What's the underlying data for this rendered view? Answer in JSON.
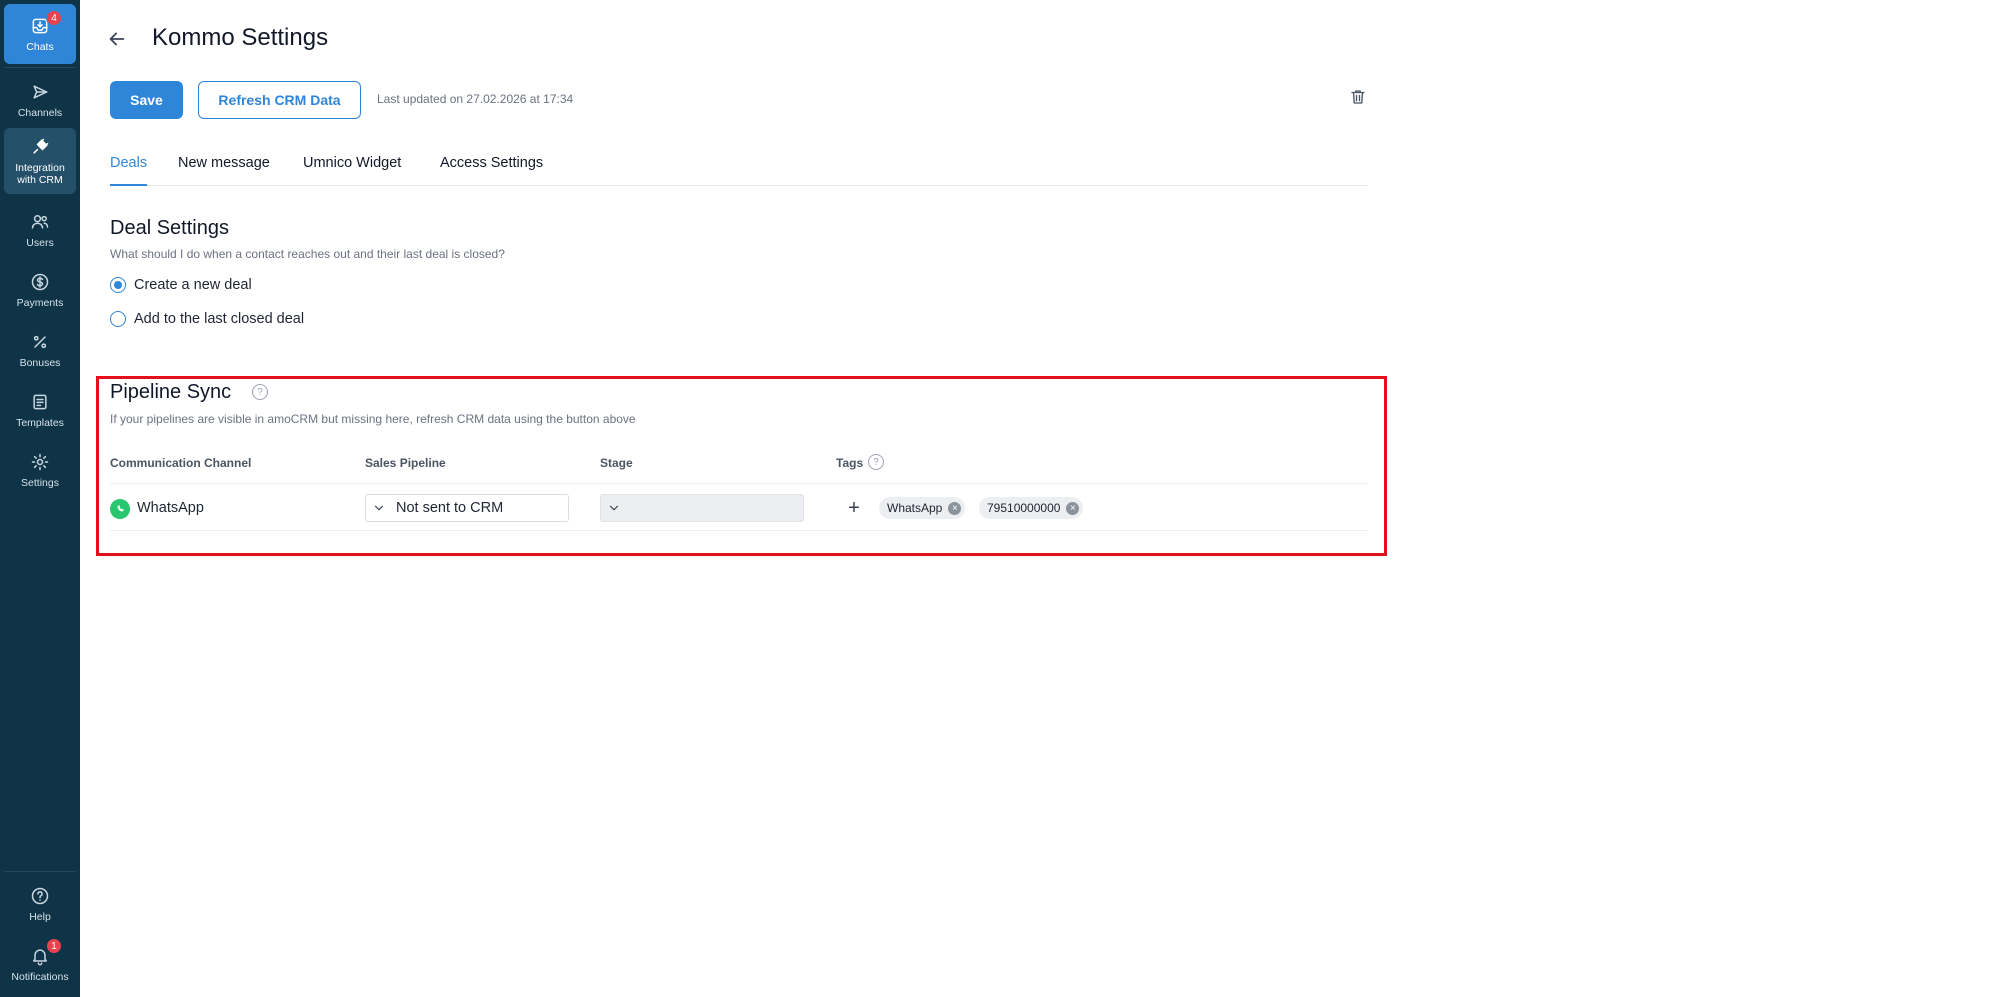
{
  "sidebar": {
    "items": [
      {
        "label": "Chats",
        "icon": "inbox-icon",
        "badge": "4"
      },
      {
        "label": "Channels",
        "icon": "send-icon"
      },
      {
        "label": "Integration with CRM",
        "icon": "plug-icon"
      },
      {
        "label": "Users",
        "icon": "users-icon"
      },
      {
        "label": "Payments",
        "icon": "dollar-icon"
      },
      {
        "label": "Bonuses",
        "icon": "percent-icon"
      },
      {
        "label": "Templates",
        "icon": "document-icon"
      },
      {
        "label": "Settings",
        "icon": "gear-icon"
      }
    ],
    "bottom_items": [
      {
        "label": "Help",
        "icon": "help-circle-icon"
      },
      {
        "label": "Notifications",
        "icon": "bell-icon",
        "badge": "1"
      }
    ]
  },
  "header": {
    "title": "Kommo Settings",
    "save_label": "Save",
    "refresh_label": "Refresh CRM Data",
    "last_updated": "Last updated on 27.02.2026 at 17:34"
  },
  "tabs": [
    {
      "label": "Deals",
      "active": true
    },
    {
      "label": "New message"
    },
    {
      "label": "Umnico Widget"
    },
    {
      "label": "Access Settings"
    }
  ],
  "deal_settings": {
    "title": "Deal Settings",
    "description": "What should I do when a contact reaches out and their last deal is closed?",
    "options": [
      {
        "label": "Create a new deal",
        "selected": true
      },
      {
        "label": "Add to the last closed deal",
        "selected": false
      }
    ]
  },
  "pipeline_sync": {
    "title": "Pipeline Sync",
    "description": "If your pipelines are visible in amoCRM but missing here, refresh CRM data using the button above",
    "columns": [
      "Communication Channel",
      "Sales Pipeline",
      "Stage",
      "Tags"
    ],
    "rows": [
      {
        "channel": "WhatsApp",
        "pipeline": "Not sent to CRM",
        "stage": "",
        "tags": [
          "WhatsApp",
          "79510000000"
        ]
      }
    ]
  },
  "colors": {
    "sidebar_bg": "#0f3347",
    "accent": "#2f86d8",
    "highlight": "#e3101c",
    "badge": "#e8424e",
    "whatsapp": "#28c76f"
  }
}
